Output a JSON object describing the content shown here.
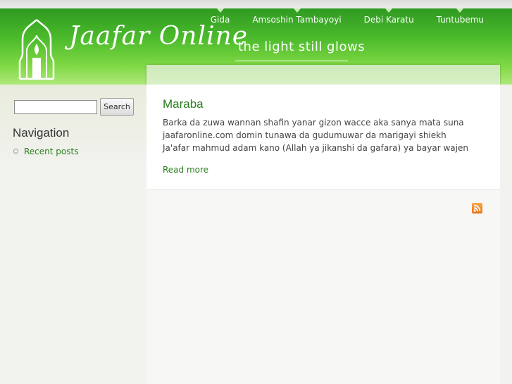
{
  "nav": {
    "items": [
      {
        "label": "Gida"
      },
      {
        "label": "Amsoshin Tambayoyi"
      },
      {
        "label": "Debi Karatu"
      },
      {
        "label": "Tuntubemu"
      }
    ]
  },
  "site": {
    "name": "Jaafar Online",
    "slogan": "the light still glows"
  },
  "search": {
    "value": "",
    "button_label": "Search"
  },
  "navigation_block": {
    "title": "Navigation",
    "items": [
      {
        "label": "Recent posts"
      }
    ]
  },
  "node": {
    "title": "Maraba",
    "body": "Barka da zuwa wannan shafin yanar gizon wacce aka sanya mata suna jaafaronline.com domin tunawa da gudumuwar da marigayi shiekh Ja'afar mahmud adam kano (Allah ya jikanshi da gafara) ya bayar wajen",
    "read_more": "Read more"
  },
  "icons": {
    "feed": "rss-feed-icon",
    "logo": "mosque-candle-logo-icon"
  },
  "colors": {
    "brand_green": "#4dbb2c",
    "link_green": "#2a7e1e",
    "feed_orange": "#e2731a"
  }
}
